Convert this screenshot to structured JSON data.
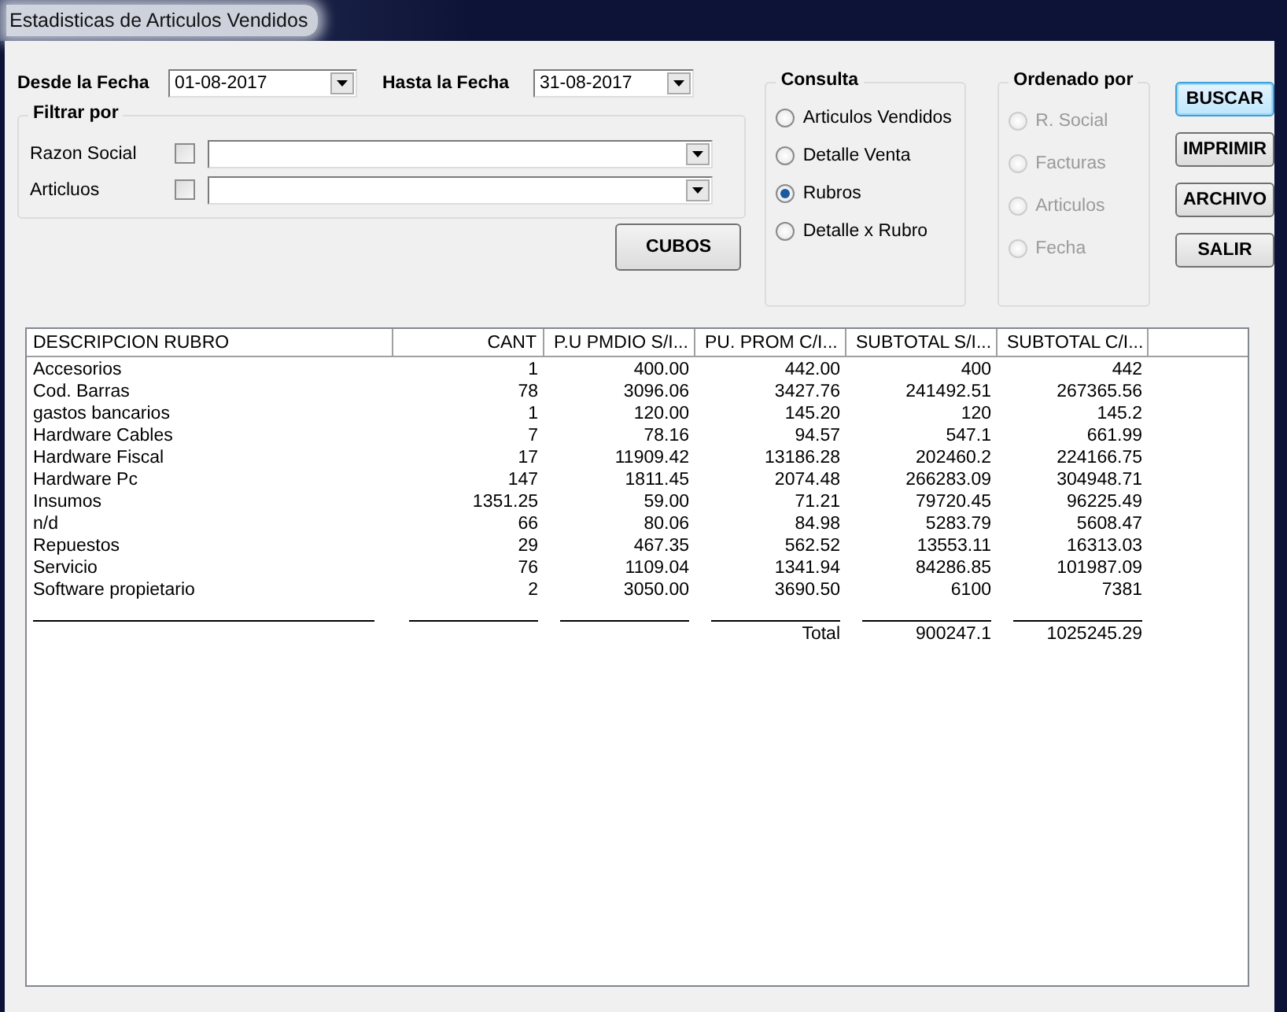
{
  "window": {
    "title": "Estadisticas de Articulos Vendidos"
  },
  "desde": {
    "label": "Desde la Fecha",
    "value": "01-08-2017"
  },
  "hasta": {
    "label": "Hasta la Fecha",
    "value": "31-08-2017"
  },
  "filtro": {
    "title": "Filtrar por",
    "rows": [
      {
        "label": "Razon Social",
        "checked": false
      },
      {
        "label": "Articluos",
        "checked": false
      }
    ]
  },
  "cubos_button": "CUBOS",
  "consulta": {
    "title": "Consulta",
    "options": [
      {
        "label": "Articulos Vendidos",
        "selected": false
      },
      {
        "label": "Detalle Venta",
        "selected": false
      },
      {
        "label": "Rubros",
        "selected": true
      },
      {
        "label": "Detalle x Rubro",
        "selected": false
      }
    ]
  },
  "ordenado": {
    "title": "Ordenado por",
    "options": [
      {
        "label": "R. Social",
        "selected": false,
        "disabled": true
      },
      {
        "label": "Facturas",
        "selected": false,
        "disabled": true
      },
      {
        "label": "Articulos",
        "selected": false,
        "disabled": true
      },
      {
        "label": "Fecha",
        "selected": false,
        "disabled": true
      }
    ]
  },
  "buttons": [
    {
      "label": "BUSCAR",
      "default": true
    },
    {
      "label": "IMPRIMIR",
      "default": false
    },
    {
      "label": "ARCHIVO",
      "default": false
    },
    {
      "label": "SALIR",
      "default": false
    }
  ],
  "table": {
    "columns": [
      "DESCRIPCION RUBRO",
      "CANT",
      "P.U PMDIO S/I...",
      "PU. PROM C/I...",
      "SUBTOTAL S/I...",
      "SUBTOTAL C/I..."
    ],
    "rows": [
      [
        "Accesorios",
        "1",
        "400.00",
        "442.00",
        "400",
        "442"
      ],
      [
        "Cod. Barras",
        "78",
        "3096.06",
        "3427.76",
        "241492.51",
        "267365.56"
      ],
      [
        "gastos bancarios",
        "1",
        "120.00",
        "145.20",
        "120",
        "145.2"
      ],
      [
        "Hardware  Cables",
        "7",
        "78.16",
        "94.57",
        "547.1",
        "661.99"
      ],
      [
        "Hardware  Fiscal",
        "17",
        "11909.42",
        "13186.28",
        "202460.2",
        "224166.75"
      ],
      [
        "Hardware Pc",
        "147",
        "1811.45",
        "2074.48",
        "266283.09",
        "304948.71"
      ],
      [
        "Insumos",
        "1351.25",
        "59.00",
        "71.21",
        "79720.45",
        "96225.49"
      ],
      [
        "n/d",
        "66",
        "80.06",
        "84.98",
        "5283.79",
        "5608.47"
      ],
      [
        "Repuestos",
        "29",
        "467.35",
        "562.52",
        "13553.11",
        "16313.03"
      ],
      [
        "Servicio",
        "76",
        "1109.04",
        "1341.94",
        "84286.85",
        "101987.09"
      ],
      [
        "Software propietario",
        "2",
        "3050.00",
        "3690.50",
        "6100",
        "7381"
      ]
    ],
    "total": {
      "label": "Total",
      "values": [
        "900247.1",
        "1025245.29"
      ]
    }
  }
}
